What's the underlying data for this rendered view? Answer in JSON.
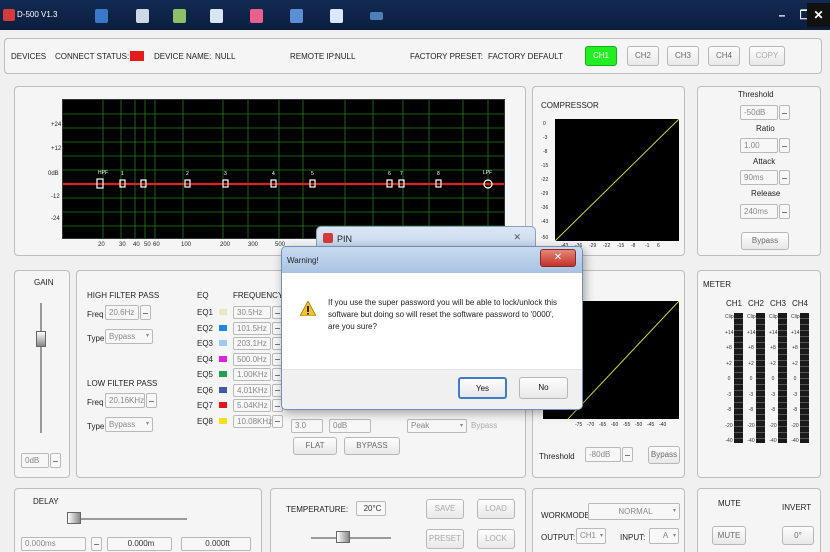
{
  "window": {
    "title": "D-500 V1.3"
  },
  "colors": {
    "connect_status": "#e41b1b",
    "ch1_active": "#22ee22",
    "eq_curve": "#dd2222",
    "compressor_line": "#d6d62a"
  },
  "header": {
    "devices": "DEVICES",
    "connect_status": "CONNECT STATUS:",
    "device_name": "DEVICE NAME:",
    "device_name_value": "NULL",
    "remote_ip": "REMOTE IP:",
    "remote_ip_value": "NULL",
    "factory_preset": "FACTORY PRESET:",
    "factory_preset_value": "FACTORY DEFAULT",
    "channels": [
      "CH1",
      "CH2",
      "CH3",
      "CH4"
    ],
    "copy": "COPY"
  },
  "eq_graph": {
    "y_ticks": [
      "+24",
      "+12",
      "0dB",
      "-12",
      "-24"
    ],
    "x_ticks": [
      "20",
      "30",
      "40",
      "50",
      "60",
      "100",
      "200",
      "300",
      "500"
    ],
    "markers": [
      "HPF",
      "1",
      "2",
      "3",
      "4",
      "5",
      "6",
      "7",
      "8",
      "LPF"
    ]
  },
  "compressor": {
    "title": "COMPRESSOR",
    "y_ticks": [
      "0",
      "-3",
      "-8",
      "-15",
      "-22",
      "-29",
      "-36",
      "-43",
      "-50"
    ],
    "x_ticks": [
      "-50",
      "-43",
      "-36",
      "-29",
      "-22",
      "-15",
      "-8",
      "-1",
      "6"
    ]
  },
  "compressor_settings": {
    "threshold_label": "Threshold",
    "threshold": "-50dB",
    "ratio_label": "Ratio",
    "ratio": "1.00",
    "attack_label": "Attack",
    "attack": "90ms",
    "release_label": "Release",
    "release": "240ms",
    "bypass": "Bypass"
  },
  "gain": {
    "title": "GAIN",
    "value": "0dB"
  },
  "filters": {
    "high_pass": "HIGH FILTER PASS",
    "freq_label": "Freq",
    "type_label": "Type",
    "hp_freq": "20.6Hz",
    "hp_type": "Bypass",
    "low_pass": "LOW FILTER PASS",
    "lp_freq": "20.16KHz",
    "lp_type": "Bypass"
  },
  "eq": {
    "eq_header": "EQ",
    "freq_header": "FREQUENCY",
    "bands": [
      {
        "name": "EQ1",
        "freq": "30.5Hz",
        "color": "#e8e8c0"
      },
      {
        "name": "EQ2",
        "freq": "101.5Hz",
        "color": "#1e88e5"
      },
      {
        "name": "EQ3",
        "freq": "203.1Hz",
        "color": "#9ec9f0"
      },
      {
        "name": "EQ4",
        "freq": "500.0Hz",
        "color": "#e020e0"
      },
      {
        "name": "EQ5",
        "freq": "1.00KHz",
        "color": "#22a050"
      },
      {
        "name": "EQ6",
        "freq": "4.01KHz",
        "color": "#3a5fa8"
      },
      {
        "name": "EQ7",
        "freq": "5.04KHz",
        "color": "#e01818"
      },
      {
        "name": "EQ8",
        "freq": "10.08KHz",
        "color": "#f0e020"
      }
    ],
    "q_value": "3.0",
    "gain_value": "0dB",
    "type_value": "Peak",
    "band_bypass": "Bypass",
    "flat": "FLAT",
    "bypass": "BYPASS"
  },
  "expander": {
    "x_ticks": [
      "-75",
      "-70",
      "-65",
      "-60",
      "-55",
      "-50",
      "-45",
      "-40"
    ],
    "threshold_label": "Threshold",
    "threshold": "-80dB",
    "bypass": "Bypass"
  },
  "meter": {
    "title": "METER",
    "channels": [
      "CH1",
      "CH2",
      "CH3",
      "CH4"
    ],
    "scale": [
      "Clip",
      "+14",
      "+8",
      "+2",
      "0",
      "-3",
      "-8",
      "-20",
      "-40"
    ]
  },
  "delay": {
    "title": "DELAY",
    "ms": "0.000ms",
    "m": "0.000m",
    "ft": "0.000ft"
  },
  "temperature": {
    "label": "TEMPERATURE:",
    "value": "20°C"
  },
  "actions": {
    "save": "SAVE",
    "load": "LOAD",
    "preset": "PRESET",
    "lock": "LOCK"
  },
  "workmode": {
    "label": "WORKMODE:",
    "value": "NORMAL",
    "output_label": "OUTPUT:",
    "output": "CH1",
    "input_label": "INPUT:",
    "input": "A"
  },
  "mute_invert": {
    "mute_title": "MUTE",
    "invert_title": "INVERT",
    "mute_button": "MUTE",
    "invert_value": "0°"
  },
  "pin_window": {
    "title": "PIN"
  },
  "warning": {
    "title": "Warning!",
    "message": "If you use the super password you will be able to lock/unlock this software but doing so will reset the software password to '0000', are you sure?",
    "yes": "Yes",
    "no": "No"
  }
}
